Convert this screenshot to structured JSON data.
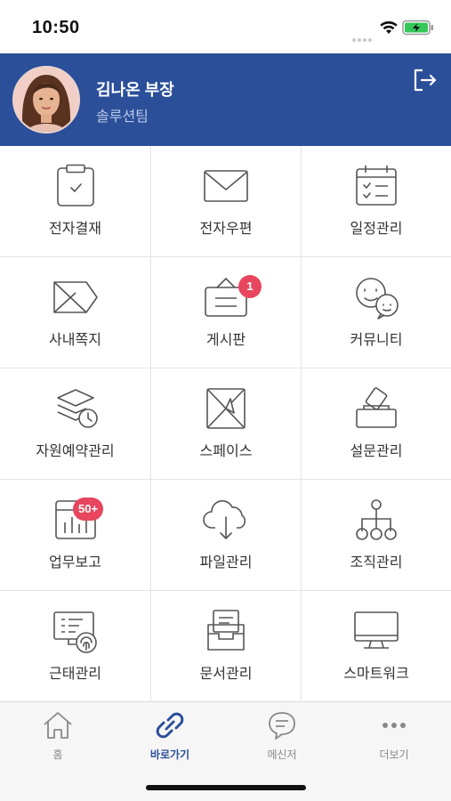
{
  "status": {
    "time": "10:50"
  },
  "profile": {
    "name": "김나온 부장",
    "team": "솔루션팀"
  },
  "menu": [
    {
      "label": "전자결재",
      "icon": "clipboard-check-icon"
    },
    {
      "label": "전자우편",
      "icon": "envelope-icon"
    },
    {
      "label": "일정관리",
      "icon": "calendar-icon"
    },
    {
      "label": "사내쪽지",
      "icon": "message-note-icon"
    },
    {
      "label": "게시판",
      "icon": "board-icon",
      "badge": "1"
    },
    {
      "label": "커뮤니티",
      "icon": "community-faces-icon"
    },
    {
      "label": "자원예약관리",
      "icon": "layers-clock-icon"
    },
    {
      "label": "스페이스",
      "icon": "space-box-icon"
    },
    {
      "label": "설문관리",
      "icon": "survey-ballot-icon"
    },
    {
      "label": "업무보고",
      "icon": "report-chart-icon",
      "badge": "50+"
    },
    {
      "label": "파일관리",
      "icon": "cloud-download-icon"
    },
    {
      "label": "조직관리",
      "icon": "org-chart-icon"
    },
    {
      "label": "근태관리",
      "icon": "fingerprint-attendance-icon"
    },
    {
      "label": "문서관리",
      "icon": "document-tray-icon"
    },
    {
      "label": "스마트워크",
      "icon": "monitor-icon"
    }
  ],
  "tabs": [
    {
      "label": "홈",
      "icon": "home-icon"
    },
    {
      "label": "바로가기",
      "icon": "link-icon",
      "active": true
    },
    {
      "label": "메신저",
      "icon": "chat-bubble-icon"
    },
    {
      "label": "더보기",
      "icon": "more-dots-icon"
    }
  ],
  "colors": {
    "header": "#2b4f99",
    "badge": "#e8465e",
    "active_tab": "#2b4f99"
  }
}
